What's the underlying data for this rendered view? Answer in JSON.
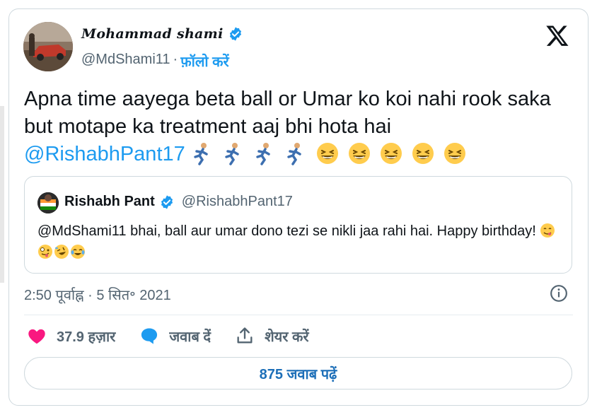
{
  "author": {
    "display_name": "Mohammad shami",
    "handle": "@MdShami11",
    "separator": "·",
    "follow_label": "फ़ॉलो करें"
  },
  "tweet": {
    "line1": "Apna time aayega beta ball or Umar ko koi nahi rook saka",
    "line2": "but motape ka treatment aaj bhi hota hai",
    "mention": "@RishabhPant17",
    "emojis": [
      "person-running-emoji",
      "person-running-emoji",
      "person-running-emoji",
      "person-running-emoji",
      "grinning-squinting-emoji",
      "grinning-squinting-emoji",
      "grinning-squinting-emoji",
      "grinning-squinting-emoji",
      "grinning-squinting-emoji"
    ]
  },
  "quote": {
    "display_name": "Rishabh Pant",
    "handle": "@RishabhPant17",
    "text": "@MdShami11 bhai, ball aur umar dono tezi se nikli jaa rahi hai. Happy birthday!",
    "emojis": [
      "face-savoring-emoji",
      "zany-face-emoji",
      "rolling-laughing-emoji",
      "tears-of-joy-emoji"
    ]
  },
  "timestamp": "2:50 पूर्वाह्न · 5 सित॰ 2021",
  "actions": {
    "likes": "37.9 हज़ार",
    "reply": "जवाब दें",
    "share": "शेयर करें"
  },
  "replies_button": "875 जवाब पढ़ें",
  "colors": {
    "accent": "#1d9bf0",
    "like": "#f91880",
    "text": "#0f1419",
    "muted": "#536471",
    "border": "#cfd9de"
  }
}
